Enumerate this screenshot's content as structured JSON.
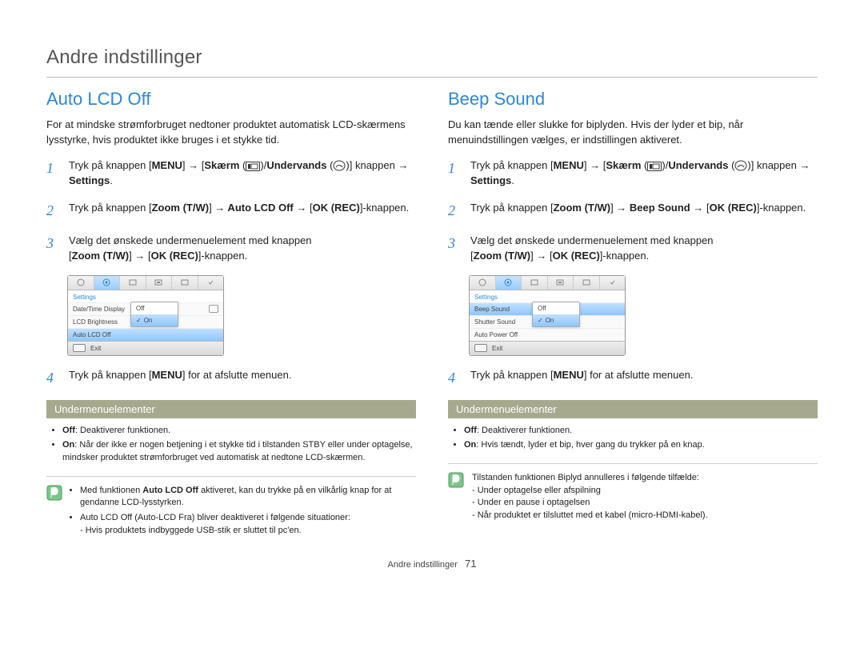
{
  "chapter_title": "Andre indstillinger",
  "footer": {
    "label": "Andre indstillinger",
    "page": "71"
  },
  "icons": {
    "screen_icon": "screen-icon",
    "underwater_icon": "underwater-icon",
    "note_icon": "note-icon"
  },
  "left": {
    "heading": "Auto LCD Off",
    "lead": "For at mindske strømforbruget nedtoner produktet automatisk LCD-skærmens lysstyrke, hvis produktet ikke bruges i et stykke tid.",
    "steps": {
      "1": {
        "num": "1",
        "pre": "Tryk på knappen [",
        "menu": "MENU",
        "mid1": "] ",
        "arrow1": "→",
        "mid2": " [",
        "skaerm": "Skærm",
        "mid3": " (",
        "mid4": ")/",
        "undervands": "Undervands",
        "mid5": " (",
        "mid6": ")] knappen ",
        "arrow2": "→",
        "settings": " Settings",
        "end": "."
      },
      "2": {
        "num": "2",
        "pre": "Tryk på knappen [",
        "zoom": "Zoom (T/W)",
        "mid1": "] ",
        "arrow1": "→",
        "target": " Auto LCD Off ",
        "arrow2": "→",
        "mid2": " [",
        "ok": "OK (REC)",
        "end": "]-knappen."
      },
      "3": {
        "num": "3",
        "line1": "Vælg det ønskede undermenuelement med knappen",
        "pre": "[",
        "zoom": "Zoom (T/W)",
        "mid1": "] ",
        "arrow": "→",
        "mid2": " [",
        "ok": "OK (REC)",
        "end": "]-knappen."
      },
      "4": {
        "num": "4",
        "pre": "Tryk på knappen [",
        "menu": "MENU",
        "end": "] for at afslutte menuen."
      }
    },
    "lcd": {
      "title": "Settings",
      "rows": [
        "Date/Time Display",
        "LCD Brightness",
        "Auto LCD Off"
      ],
      "popup": {
        "off": "Off",
        "on": "On"
      },
      "exit": "Exit"
    },
    "sub_band": "Undermenuelementer",
    "sub_items": {
      "off_label": "Off",
      "off_text": ": Deaktiverer funktionen.",
      "on_label": "On",
      "on_text": ": Når der ikke er nogen betjening i et stykke tid i tilstanden STBY eller under optagelse, mindsker produktet strømforbruget ved automatisk at nedtone LCD-skærmen."
    },
    "note": {
      "b1_pre": "Med funktionen ",
      "b1_bold": "Auto LCD Off",
      "b1_post": " aktiveret, kan du trykke på en vilkårlig knap for at gendanne LCD-lysstyrken.",
      "b2": "Auto LCD Off (Auto-LCD Fra) bliver deaktiveret i følgende situationer:",
      "b2_d1": "- Hvis produktets indbyggede USB-stik er sluttet til pc'en."
    }
  },
  "right": {
    "heading": "Beep Sound",
    "lead": "Du kan tænde eller slukke for biplyden. Hvis der lyder et bip, når menuindstillingen vælges, er indstillingen aktiveret.",
    "steps": {
      "1": {
        "num": "1",
        "pre": "Tryk på knappen [",
        "menu": "MENU",
        "mid1": "] ",
        "arrow1": "→",
        "mid2": " [",
        "skaerm": "Skærm",
        "mid3": " (",
        "mid4": ")/",
        "undervands": "Undervands",
        "mid5": " (",
        "mid6": ")] knappen ",
        "arrow2": "→",
        "settings": " Settings",
        "end": "."
      },
      "2": {
        "num": "2",
        "pre": "Tryk på knappen [",
        "zoom": "Zoom (T/W)",
        "mid1": "] ",
        "arrow1": "→",
        "target": " Beep Sound ",
        "arrow2": "→",
        "mid2": " [",
        "ok": "OK (REC)",
        "end": "]-knappen."
      },
      "3": {
        "num": "3",
        "line1": "Vælg det ønskede undermenuelement med knappen",
        "pre": "[",
        "zoom": "Zoom (T/W)",
        "mid1": "] ",
        "arrow": "→",
        "mid2": " [",
        "ok": "OK (REC)",
        "end": "]-knappen."
      },
      "4": {
        "num": "4",
        "pre": "Tryk på knappen [",
        "menu": "MENU",
        "end": "] for at afslutte menuen."
      }
    },
    "lcd": {
      "title": "Settings",
      "rows": [
        "Beep Sound",
        "Shutter Sound",
        "Auto Power Off"
      ],
      "popup": {
        "off": "Off",
        "on": "On"
      },
      "exit": "Exit"
    },
    "sub_band": "Undermenuelementer",
    "sub_items": {
      "off_label": "Off",
      "off_text": ": Deaktiverer funktionen.",
      "on_label": "On",
      "on_text": ": Hvis tændt, lyder et bip, hver gang du trykker på en knap."
    },
    "note": {
      "b1": "Tilstanden funktionen Biplyd annulleres i følgende tilfælde:",
      "d1": "- Under optagelse eller afspilning",
      "d2": "- Under en pause i optagelsen",
      "d3": "- Når produktet er tilsluttet med et kabel (micro-HDMI-kabel)."
    }
  }
}
